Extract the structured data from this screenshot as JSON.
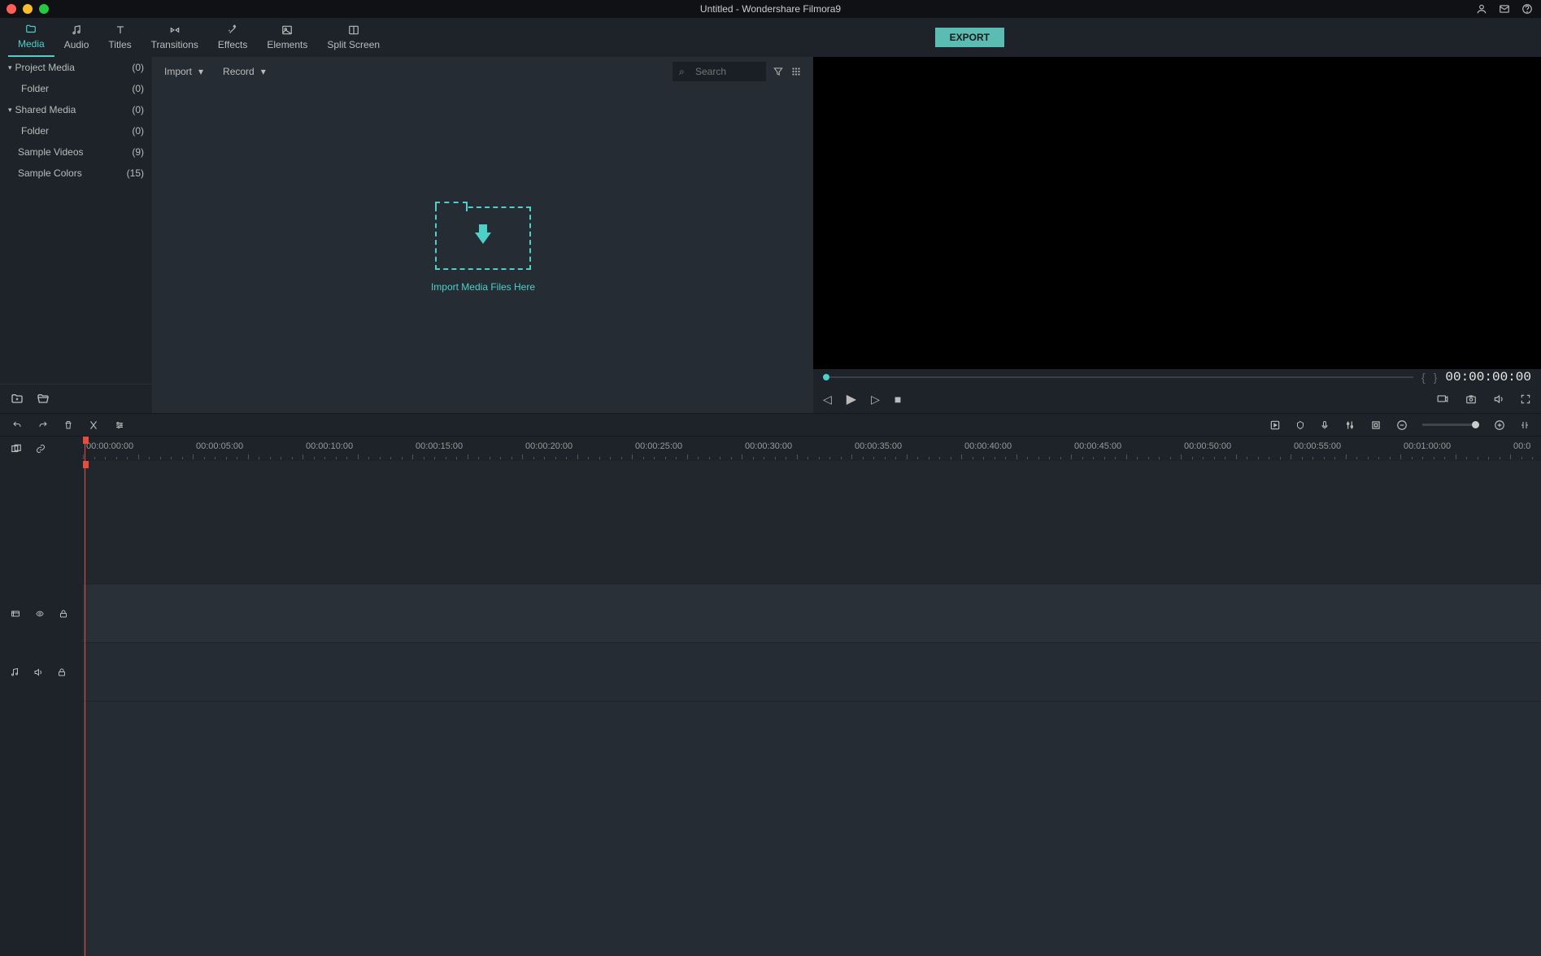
{
  "window": {
    "title": "Untitled - Wondershare Filmora9"
  },
  "tabs": [
    {
      "id": "media",
      "label": "Media",
      "icon": "folder",
      "active": true
    },
    {
      "id": "audio",
      "label": "Audio",
      "icon": "music"
    },
    {
      "id": "titles",
      "label": "Titles",
      "icon": "text"
    },
    {
      "id": "transitions",
      "label": "Transitions",
      "icon": "trans"
    },
    {
      "id": "effects",
      "label": "Effects",
      "icon": "wand"
    },
    {
      "id": "elements",
      "label": "Elements",
      "icon": "image"
    },
    {
      "id": "splitscreen",
      "label": "Split Screen",
      "icon": "split"
    }
  ],
  "export_label": "EXPORT",
  "sidebar": {
    "items": [
      {
        "label": "Project Media",
        "count": "(0)",
        "chev": true,
        "indent": false
      },
      {
        "label": "Folder",
        "count": "(0)",
        "chev": false,
        "indent": true
      },
      {
        "label": "Shared Media",
        "count": "(0)",
        "chev": true,
        "indent": false
      },
      {
        "label": "Folder",
        "count": "(0)",
        "chev": false,
        "indent": true
      },
      {
        "label": "Sample Videos",
        "count": "(9)",
        "chev": false,
        "indent": false
      },
      {
        "label": "Sample Colors",
        "count": "(15)",
        "chev": false,
        "indent": false
      }
    ]
  },
  "media_head": {
    "import_label": "Import",
    "record_label": "Record",
    "search_placeholder": "Search"
  },
  "dropzone": {
    "text": "Import Media Files Here"
  },
  "preview": {
    "timecode": "00:00:00:00"
  },
  "ruler": [
    "00:00:00:00",
    "00:00:05:00",
    "00:00:10:00",
    "00:00:15:00",
    "00:00:20:00",
    "00:00:25:00",
    "00:00:30:00",
    "00:00:35:00",
    "00:00:40:00",
    "00:00:45:00",
    "00:00:50:00",
    "00:00:55:00",
    "00:01:00:00",
    "00:0"
  ],
  "colors": {
    "accent": "#4dd0c8",
    "bg": "#1e2329",
    "panel": "#262c34"
  }
}
